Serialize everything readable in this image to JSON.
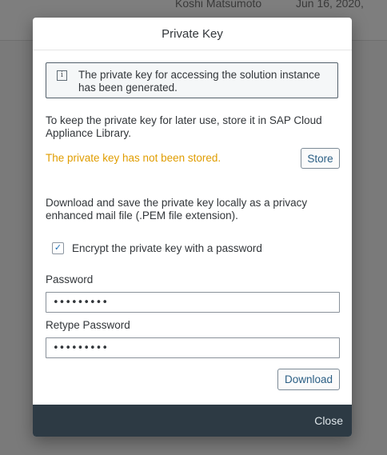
{
  "background": {
    "row_name_line1": "Koshi Matsumoto",
    "row_date_line1": "Jun 16, 2020,"
  },
  "dialog": {
    "title": "Private Key",
    "info_message": "The private key for accessing the solution instance has been generated.",
    "store_instructions": "To keep the private key for later use, store it in SAP Cloud Appliance Library.",
    "not_stored_warning": "The private key has not been stored.",
    "store_button_label": "Store",
    "download_instructions": "Download and save the private key locally as a privacy enhanced mail file (.PEM file extension).",
    "encrypt_checkbox": {
      "label": "Encrypt the private key with a password",
      "checked": true
    },
    "password_label": "Password",
    "password_value": "•••••••••",
    "retype_password_label": "Retype Password",
    "retype_password_value": "•••••••••",
    "download_button_label": "Download",
    "close_label": "Close"
  },
  "colors": {
    "warning": "#e09d00",
    "footer": "#2d3a44",
    "button_text": "#2a5e84"
  },
  "icons": [
    "info-icon",
    "checkmark-icon"
  ]
}
